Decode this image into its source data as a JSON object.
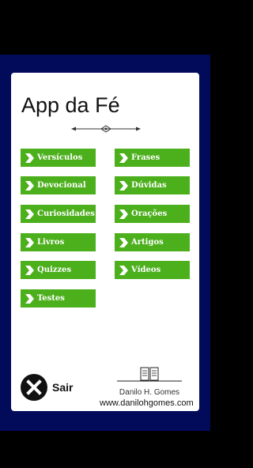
{
  "app": {
    "title": "App da Fé"
  },
  "menu": {
    "left": [
      {
        "label": "Versículos",
        "icon": "chevron-right-icon"
      },
      {
        "label": "Devocional",
        "icon": "chevron-right-icon"
      },
      {
        "label": "Curiosidades",
        "icon": "chevron-right-icon"
      },
      {
        "label": "Livros",
        "icon": "chevron-right-icon"
      },
      {
        "label": "Quizzes",
        "icon": "chevron-right-icon"
      },
      {
        "label": "Testes",
        "icon": "chevron-right-icon"
      }
    ],
    "right": [
      {
        "label": "Frases",
        "icon": "chevron-right-icon"
      },
      {
        "label": "Dúvidas",
        "icon": "chevron-right-icon"
      },
      {
        "label": "Orações",
        "icon": "chevron-right-icon"
      },
      {
        "label": "Artigos",
        "icon": "chevron-right-icon"
      },
      {
        "label": "Vídeos",
        "icon": "chevron-right-icon"
      }
    ]
  },
  "footer": {
    "exit_label": "Sair",
    "exit_icon": "close-icon",
    "author_name": "Danilo H. Gomes",
    "author_icon": "open-book-icon",
    "website": "www.danilohgomes.com"
  },
  "colors": {
    "button_green": "#4caf1c",
    "background_navy": "#020a5a",
    "card": "#ffffff"
  }
}
